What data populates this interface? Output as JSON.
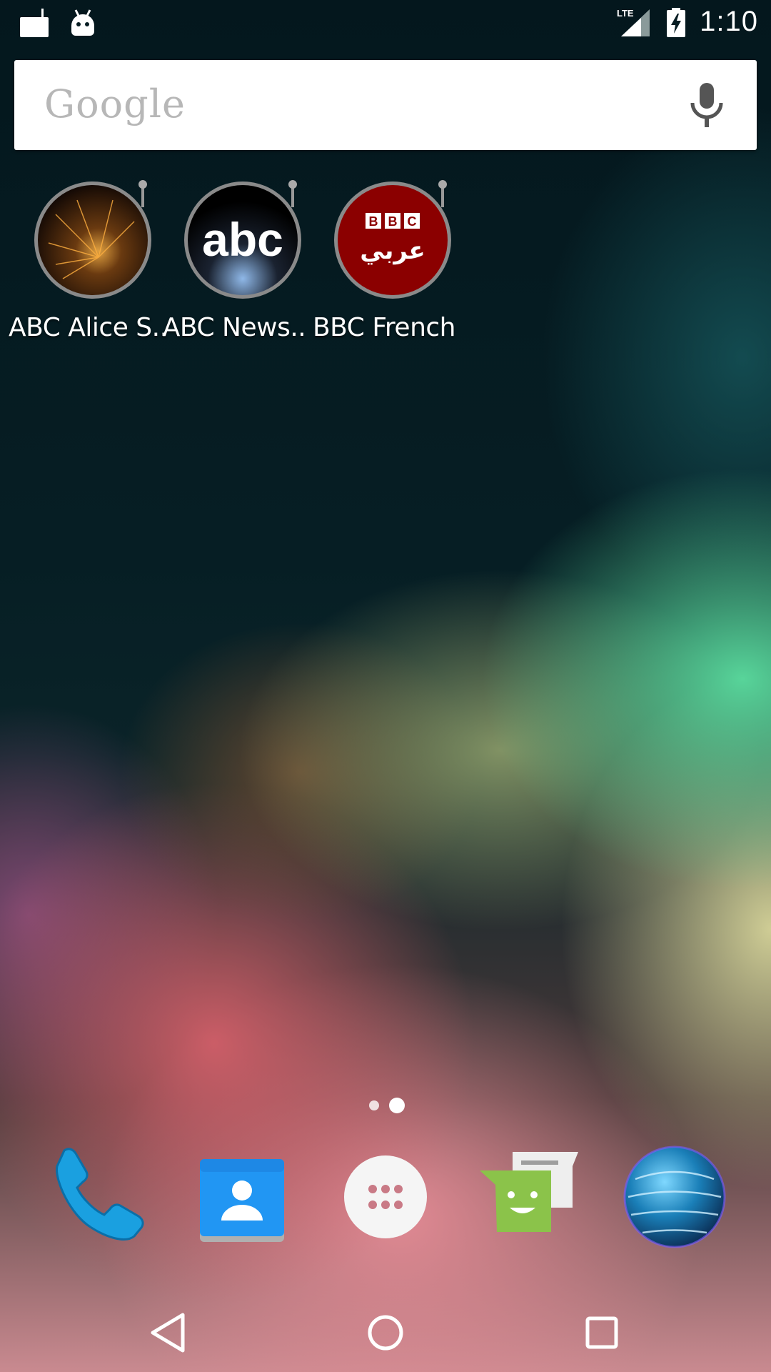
{
  "status_bar": {
    "time": "1:10",
    "network": "LTE",
    "icons": [
      "radio-notification-icon",
      "android-notification-icon",
      "lte-signal-icon",
      "battery-charging-icon"
    ]
  },
  "search": {
    "logo": "Google",
    "mic_icon": "mic-icon"
  },
  "apps": [
    {
      "label": "ABC Alice S..",
      "icon": "sparks-radio-icon"
    },
    {
      "label": "ABC News..",
      "icon": "abc-logo-radio-icon"
    },
    {
      "label": "BBC French",
      "icon": "bbc-arabic-radio-icon",
      "logo_text": "BBC",
      "logo_subtext": "عربي"
    }
  ],
  "page_indicator": {
    "pages": 2,
    "current": 2
  },
  "dock": [
    {
      "icon": "phone-icon"
    },
    {
      "icon": "contacts-icon"
    },
    {
      "icon": "app-drawer-icon"
    },
    {
      "icon": "messaging-icon"
    },
    {
      "icon": "globe-browser-icon"
    }
  ],
  "nav_bar": {
    "buttons": [
      "back-icon",
      "home-icon",
      "recents-icon"
    ]
  },
  "colors": {
    "bbc_red": "#8b0000",
    "dock_phone_blue": "#1aa0e0",
    "messaging_green": "#8bc34a"
  }
}
